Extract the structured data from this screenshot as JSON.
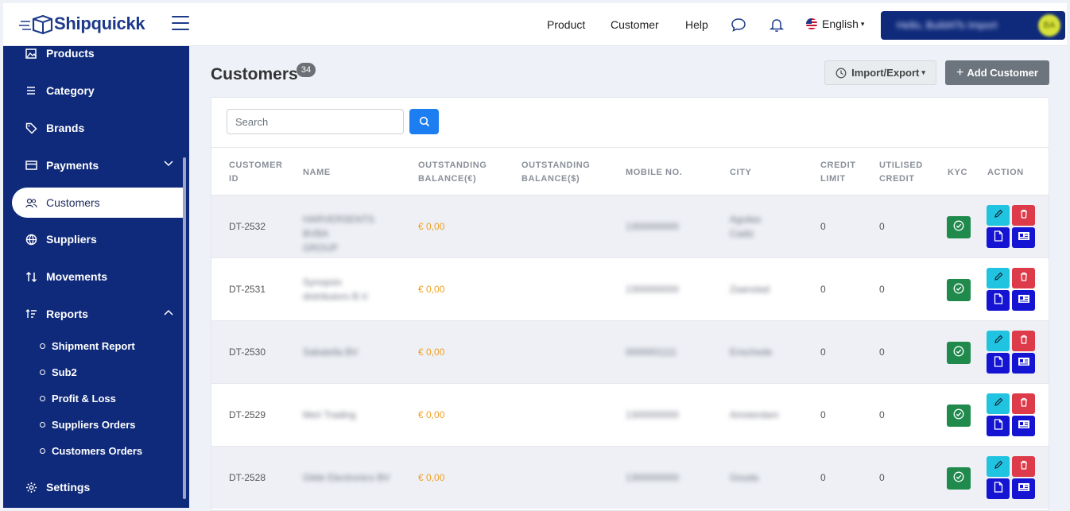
{
  "header": {
    "logo_text": "Shipquickk",
    "nav": [
      "Product",
      "Customer",
      "Help"
    ],
    "language": "English",
    "user_name": "Hello, Build4Ts Import",
    "user_initials": "BA"
  },
  "sidebar": {
    "items": [
      {
        "label": "Products",
        "icon": "image-icon"
      },
      {
        "label": "Category",
        "icon": "list-icon"
      },
      {
        "label": "Brands",
        "icon": "tag-icon"
      },
      {
        "label": "Payments",
        "icon": "credit-card-icon"
      },
      {
        "label": "Customers",
        "icon": "users-icon"
      },
      {
        "label": "Suppliers",
        "icon": "globe-icon"
      },
      {
        "label": "Movements",
        "icon": "arrows-icon"
      },
      {
        "label": "Reports",
        "icon": "sort-icon"
      },
      {
        "label": "Settings",
        "icon": "gear-icon"
      }
    ],
    "report_subitems": [
      "Shipment Report",
      "Sub2",
      "Profit & Loss",
      "Suppliers Orders",
      "Customers Orders"
    ]
  },
  "page": {
    "title": "Customers",
    "count": "34",
    "import_export_label": "Import/Export",
    "add_label": "Add Customer"
  },
  "search": {
    "placeholder": "Search"
  },
  "table": {
    "columns": [
      "CUSTOMER\nID",
      "NAME",
      "OUTSTANDING\nBALANCE(€)",
      "OUTSTANDING\nBALANCE($)",
      "MOBILE NO.",
      "CITY",
      "CREDIT\nLIMIT",
      "UTILISED\nCREDIT",
      "KYC",
      "ACTION"
    ],
    "rows": [
      {
        "id": "DT-2532",
        "name": "HARVERSENTS BVBA\nGROUP",
        "balance_eur": "€ 0,00",
        "balance_usd": "",
        "mobile": "1300000000",
        "city": "Aguilas\nCadiz",
        "credit_limit": "0",
        "utilised": "0"
      },
      {
        "id": "DT-2531",
        "name": "Synopsis\ndistributors B.V.",
        "balance_eur": "€ 0,00",
        "balance_usd": "",
        "mobile": "1300000000",
        "city": "Zaanstad",
        "credit_limit": "0",
        "utilised": "0"
      },
      {
        "id": "DT-2530",
        "name": "Sabatella BV",
        "balance_eur": "€ 0,00",
        "balance_usd": "",
        "mobile": "0000001111",
        "city": "Enschede",
        "credit_limit": "0",
        "utilised": "0"
      },
      {
        "id": "DT-2529",
        "name": "Meri Trading",
        "balance_eur": "€ 0,00",
        "balance_usd": "",
        "mobile": "1300000000",
        "city": "Amsterdam",
        "credit_limit": "0",
        "utilised": "0"
      },
      {
        "id": "DT-2528",
        "name": "Gilde Electronics BV",
        "balance_eur": "€ 0,00",
        "balance_usd": "",
        "mobile": "1300000000",
        "city": "Gouda",
        "credit_limit": "0",
        "utilised": "0"
      }
    ]
  },
  "colors": {
    "sidebar": "#0f2a7a",
    "primary": "#1c7ef0",
    "kyc": "#1f8a4c",
    "edit": "#20c3e0",
    "delete": "#dd3b4a",
    "doc": "#1414d2",
    "balance": "#f0a020"
  }
}
